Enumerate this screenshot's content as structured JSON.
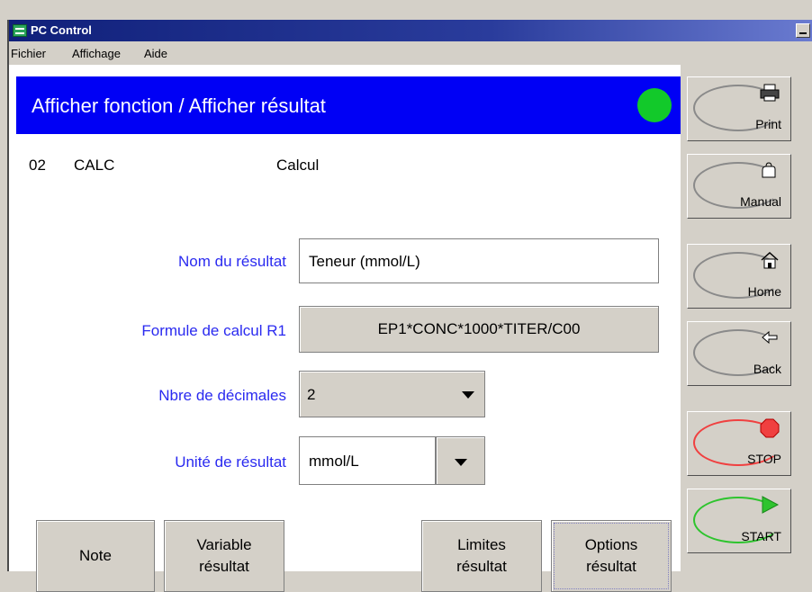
{
  "window": {
    "title": "PC Control"
  },
  "menu": {
    "items": [
      "Fichier",
      "Affichage",
      "Aide"
    ]
  },
  "header": {
    "title": "Afficher fonction / Afficher résultat",
    "status_color": "#12c92a"
  },
  "function": {
    "number": "02",
    "code": "CALC",
    "name": "Calcul"
  },
  "form": {
    "result_name": {
      "label": "Nom du résultat",
      "value": "Teneur (mmol/L)"
    },
    "formula": {
      "label": "Formule de calcul R1",
      "value": "EP1*CONC*1000*TITER/C00"
    },
    "decimals": {
      "label": "Nbre de décimales",
      "value": "2"
    },
    "unit": {
      "label": "Unité de résultat",
      "value": "mmol/L"
    }
  },
  "bottom_buttons": {
    "note": "Note",
    "variable": {
      "line1": "Variable",
      "line2": "résultat"
    },
    "limits": {
      "line1": "Limites",
      "line2": "résultat"
    },
    "options": {
      "line1": "Options",
      "line2": "résultat"
    }
  },
  "sidebar": {
    "print": {
      "label": "Print",
      "icon": "printer-icon"
    },
    "manual": {
      "label": "Manual",
      "icon": "hand-icon"
    },
    "home": {
      "label": "Home",
      "icon": "house-icon"
    },
    "back": {
      "label": "Back",
      "icon": "back-arrow-icon"
    },
    "stop": {
      "label": "STOP",
      "icon": "stop-octagon-icon",
      "color": "#f04040"
    },
    "start": {
      "label": "START",
      "icon": "play-triangle-icon",
      "color": "#2ec42e"
    }
  }
}
